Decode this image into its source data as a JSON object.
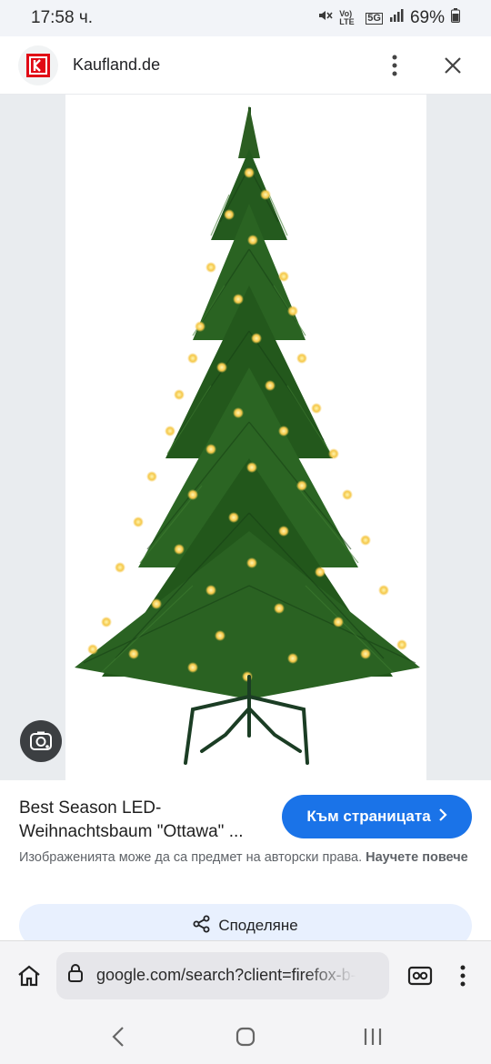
{
  "status_bar": {
    "time": "17:58 ч.",
    "mute_icon": "mute-icon",
    "network_label": "Vo) LTE",
    "fiveg_label": "5G",
    "battery_percent": "69%"
  },
  "header": {
    "site_name": "Kaufland.de",
    "logo_icon": "kaufland-logo-icon",
    "more_icon": "more-vert-icon",
    "close_icon": "close-icon"
  },
  "image": {
    "subject": "christmas-tree-image",
    "lens_icon": "google-lens-icon"
  },
  "info": {
    "title": "Best Season LED-Weihnachtsbaum \"Ottawa\" ...",
    "visit_button_label": "Към страницата",
    "copyright_text": "Изображенията може да са предмет на авторски права.",
    "learn_more_label": "Научете повече",
    "share_label": "Споделяне"
  },
  "url_bar": {
    "url": "google.com/search?client=firefox-b-",
    "home_icon": "home-icon",
    "lock_icon": "lock-icon",
    "tabs_icon": "private-tabs-icon",
    "menu_icon": "more-vert-icon"
  },
  "nav_bar": {
    "back_icon": "back-icon",
    "home_icon": "home-circle-icon",
    "recents_icon": "recents-icon"
  }
}
